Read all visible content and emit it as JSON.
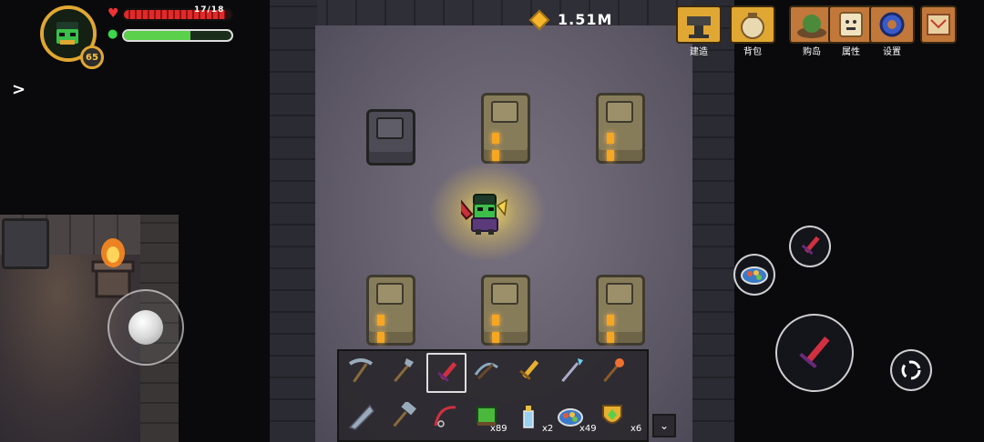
{
  "hud": {
    "level": "65",
    "hp_text": "17/18",
    "hp_fraction": 0.94,
    "mp_fraction": 0.62,
    "side_arrow": ">"
  },
  "currency": {
    "amount": "1.51M",
    "icon": "gem-icon"
  },
  "top_menu": [
    {
      "label": "建造",
      "icon": "anvil-icon",
      "color": "#e0a732"
    },
    {
      "label": "背包",
      "icon": "bag-icon",
      "color": "#e0a732"
    },
    {
      "label": "购岛",
      "icon": "island-icon",
      "color": "#c2783a"
    },
    {
      "label": "属性",
      "icon": "scroll-face-icon",
      "color": "#c2783a"
    },
    {
      "label": "设置",
      "icon": "gear-icon",
      "color": "#c2783a"
    },
    {
      "label": "",
      "icon": "map-icon",
      "color": "#c2783a"
    }
  ],
  "hotbar": {
    "row1": [
      {
        "icon": "pickaxe-icon"
      },
      {
        "icon": "shovel-icon"
      },
      {
        "icon": "red-sword-icon",
        "selected": true
      },
      {
        "icon": "crossbow-icon"
      },
      {
        "icon": "golden-sword-icon"
      },
      {
        "icon": "ice-spear-icon"
      },
      {
        "icon": "fire-staff-icon"
      }
    ],
    "row2": [
      {
        "icon": "drill-icon",
        "count": ""
      },
      {
        "icon": "hammer-icon",
        "count": ""
      },
      {
        "icon": "fishing-rod-icon",
        "count": ""
      },
      {
        "icon": "green-block-icon",
        "count": "x89"
      },
      {
        "icon": "potion-bottle-icon",
        "count": "x2"
      },
      {
        "icon": "food-plate-icon",
        "count": "x49"
      },
      {
        "icon": "shield-gem-icon",
        "count": "x6"
      }
    ],
    "dropdown": "⌄"
  },
  "colors": {
    "gold": "#e0a732",
    "hp": "#e02a2a",
    "mp": "#5bd04a",
    "pedestal_lit": "#f5a623"
  }
}
